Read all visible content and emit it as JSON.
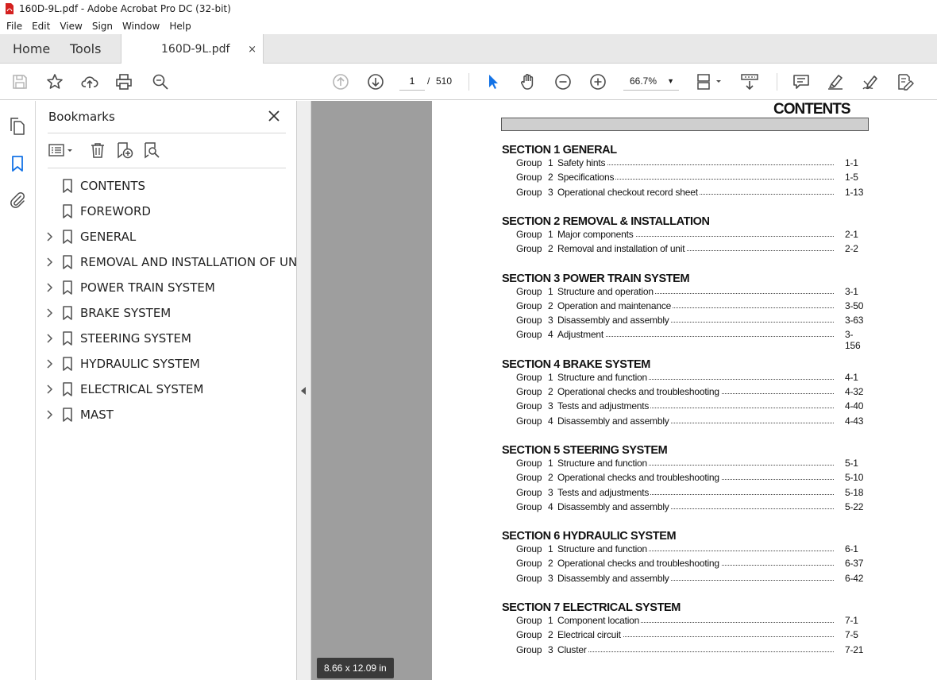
{
  "window": {
    "title": "160D-9L.pdf - Adobe Acrobat Pro DC (32-bit)"
  },
  "menu": [
    "File",
    "Edit",
    "View",
    "Sign",
    "Window",
    "Help"
  ],
  "tabs": {
    "home": "Home",
    "tools": "Tools",
    "document": "160D-9L.pdf",
    "close_symbol": "×"
  },
  "toolbar": {
    "page_current": "1",
    "page_separator": "/",
    "page_total": "510",
    "zoom": "66.7%"
  },
  "bookmarks": {
    "title": "Bookmarks",
    "items": [
      {
        "label": "CONTENTS",
        "expandable": false
      },
      {
        "label": "FOREWORD",
        "expandable": false
      },
      {
        "label": "GENERAL",
        "expandable": true
      },
      {
        "label": "REMOVAL AND INSTALLATION OF UNIT",
        "expandable": true
      },
      {
        "label": "POWER TRAIN SYSTEM",
        "expandable": true
      },
      {
        "label": "BRAKE SYSTEM",
        "expandable": true
      },
      {
        "label": "STEERING SYSTEM",
        "expandable": true
      },
      {
        "label": "HYDRAULIC SYSTEM",
        "expandable": true
      },
      {
        "label": "ELECTRICAL SYSTEM",
        "expandable": true
      },
      {
        "label": "MAST",
        "expandable": true
      }
    ]
  },
  "document": {
    "page_size": "8.66 x 12.09 in",
    "toc_title": "CONTENTS",
    "sections": [
      {
        "heading": "SECTION  1  GENERAL",
        "groups": [
          {
            "group": "Group",
            "num": "1",
            "title": "Safety hints",
            "page": "1-1"
          },
          {
            "group": "Group",
            "num": "2",
            "title": "Specifications",
            "page": "1-5"
          },
          {
            "group": "Group",
            "num": "3",
            "title": "Operational checkout record sheet",
            "page": "1-13"
          }
        ]
      },
      {
        "heading": "SECTION  2  REMOVAL & INSTALLATION",
        "groups": [
          {
            "group": "Group",
            "num": "1",
            "title": "Major components",
            "page": "2-1"
          },
          {
            "group": "Group",
            "num": "2",
            "title": "Removal and installation of unit",
            "page": "2-2"
          }
        ]
      },
      {
        "heading": "SECTION  3  POWER TRAIN SYSTEM",
        "groups": [
          {
            "group": "Group",
            "num": "1",
            "title": "Structure and operation",
            "page": "3-1"
          },
          {
            "group": "Group",
            "num": "2",
            "title": "Operation and maintenance",
            "page": "3-50"
          },
          {
            "group": "Group",
            "num": "3",
            "title": "Disassembly and assembly",
            "page": "3-63"
          },
          {
            "group": "Group",
            "num": "4",
            "title": "Adjustment",
            "page": "3-156"
          }
        ]
      },
      {
        "heading": "SECTION  4  BRAKE SYSTEM",
        "groups": [
          {
            "group": "Group",
            "num": "1",
            "title": "Structure and function",
            "page": "4-1"
          },
          {
            "group": "Group",
            "num": "2",
            "title": "Operational checks and troubleshooting",
            "page": "4-32"
          },
          {
            "group": "Group",
            "num": "3",
            "title": "Tests and adjustments",
            "page": "4-40"
          },
          {
            "group": "Group",
            "num": "4",
            "title": "Disassembly and assembly",
            "page": "4-43"
          }
        ]
      },
      {
        "heading": "SECTION  5  STEERING SYSTEM",
        "groups": [
          {
            "group": "Group",
            "num": "1",
            "title": "Structure and function",
            "page": "5-1"
          },
          {
            "group": "Group",
            "num": "2",
            "title": "Operational checks and troubleshooting",
            "page": "5-10"
          },
          {
            "group": "Group",
            "num": "3",
            "title": "Tests and adjustments",
            "page": "5-18"
          },
          {
            "group": "Group",
            "num": "4",
            "title": "Disassembly and assembly",
            "page": "5-22"
          }
        ]
      },
      {
        "heading": "SECTION  6  HYDRAULIC SYSTEM",
        "groups": [
          {
            "group": "Group",
            "num": "1",
            "title": "Structure and function",
            "page": "6-1"
          },
          {
            "group": "Group",
            "num": "2",
            "title": "Operational checks and troubleshooting",
            "page": "6-37"
          },
          {
            "group": "Group",
            "num": "3",
            "title": "Disassembly and assembly",
            "page": "6-42"
          }
        ]
      },
      {
        "heading": "SECTION  7  ELECTRICAL SYSTEM",
        "groups": [
          {
            "group": "Group",
            "num": "1",
            "title": "Component location",
            "page": "7-1"
          },
          {
            "group": "Group",
            "num": "2",
            "title": "Electrical circuit",
            "page": "7-5"
          },
          {
            "group": "Group",
            "num": "3",
            "title": "Cluster",
            "page": "7-21"
          }
        ]
      }
    ]
  },
  "colors": {
    "accent": "#1473e6",
    "pdf_red": "#d4201f",
    "icon": "#4b4b4b"
  }
}
